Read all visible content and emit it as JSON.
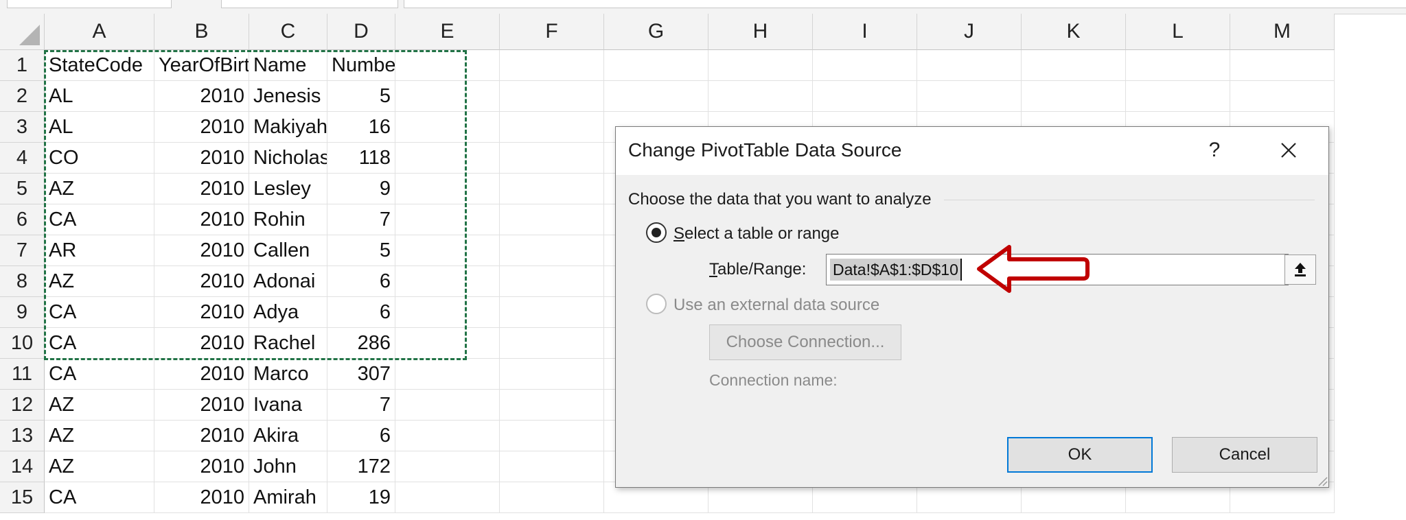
{
  "sheet": {
    "columns": [
      "A",
      "B",
      "C",
      "D",
      "E",
      "F",
      "G",
      "H",
      "I",
      "J",
      "K",
      "L",
      "M"
    ],
    "row_numbers": [
      "1",
      "2",
      "3",
      "4",
      "5",
      "6",
      "7",
      "8",
      "9",
      "10",
      "11",
      "12",
      "13",
      "14",
      "15"
    ],
    "rows": [
      [
        "StateCode",
        "YearOfBirth",
        "Name",
        "Number"
      ],
      [
        "AL",
        "2010",
        "Jenesis",
        "5"
      ],
      [
        "AL",
        "2010",
        "Makiyah",
        "16"
      ],
      [
        "CO",
        "2010",
        "Nicholas",
        "118"
      ],
      [
        "AZ",
        "2010",
        "Lesley",
        "9"
      ],
      [
        "CA",
        "2010",
        "Rohin",
        "7"
      ],
      [
        "AR",
        "2010",
        "Callen",
        "5"
      ],
      [
        "AZ",
        "2010",
        "Adonai",
        "6"
      ],
      [
        "CA",
        "2010",
        "Adya",
        "6"
      ],
      [
        "CA",
        "2010",
        "Rachel",
        "286"
      ],
      [
        "CA",
        "2010",
        "Marco",
        "307"
      ],
      [
        "AZ",
        "2010",
        "Ivana",
        "7"
      ],
      [
        "AZ",
        "2010",
        "Akira",
        "6"
      ],
      [
        "AZ",
        "2010",
        "John",
        "172"
      ],
      [
        "CA",
        "2010",
        "Amirah",
        "19"
      ]
    ],
    "selection_color": "#217346"
  },
  "dialog": {
    "title": "Change PivotTable Data Source",
    "help_label": "?",
    "close_icon": "close-icon",
    "group_label": "Choose the data that you want to analyze",
    "option_table": {
      "accel": "S",
      "rest": "elect a table or range",
      "checked": true
    },
    "table_range_label": {
      "accel": "T",
      "rest": "able/Range:"
    },
    "table_range_value": "Data!$A$1:$D$10",
    "collapse_icon": "collapse-dialog-icon",
    "option_external": {
      "label": "Use an external data source",
      "checked": false,
      "disabled": true
    },
    "choose_connection_label": "Choose Connection...",
    "connection_name_label": "Connection name:",
    "ok_label": "OK",
    "cancel_label": "Cancel",
    "annotation_arrow_icon": "red-arrow-icon",
    "annotation_color": "#c00000"
  }
}
